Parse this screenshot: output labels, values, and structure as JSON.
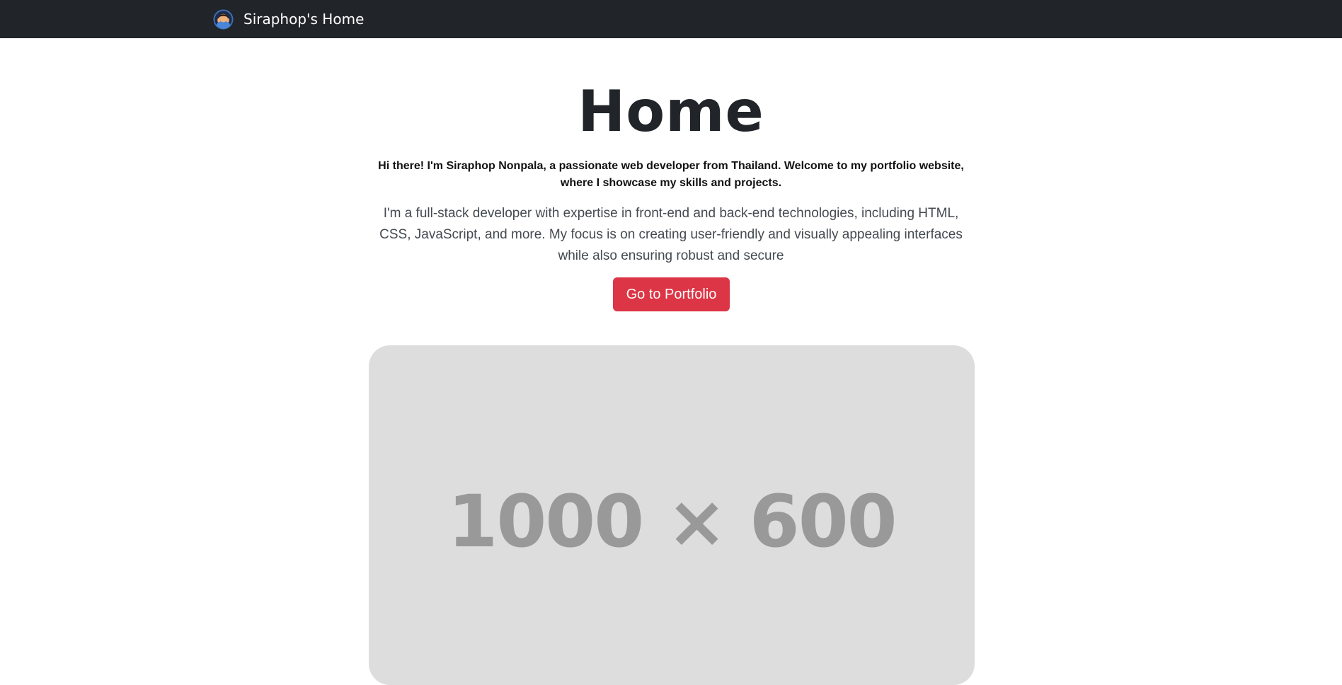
{
  "navbar": {
    "brand_text": "Siraphop's Home",
    "logo_icon": "avatar-icon",
    "background": "#212529"
  },
  "hero": {
    "title": "Home",
    "intro": "Hi there! I'm Siraphop Nonpala, a passionate web developer from Thailand. Welcome to my portfolio website, where I showcase my skills and projects.",
    "description": "I'm a full-stack developer with expertise in front-end and back-end technologies, including HTML, CSS, JavaScript, and more. My focus is on creating user-friendly and visually appealing interfaces while also ensuring robust and secure",
    "cta_label": "Go to Portfolio",
    "cta_color": "#dc3545"
  },
  "image_placeholder": {
    "label": "1000 × 600",
    "background": "#dddddd"
  }
}
